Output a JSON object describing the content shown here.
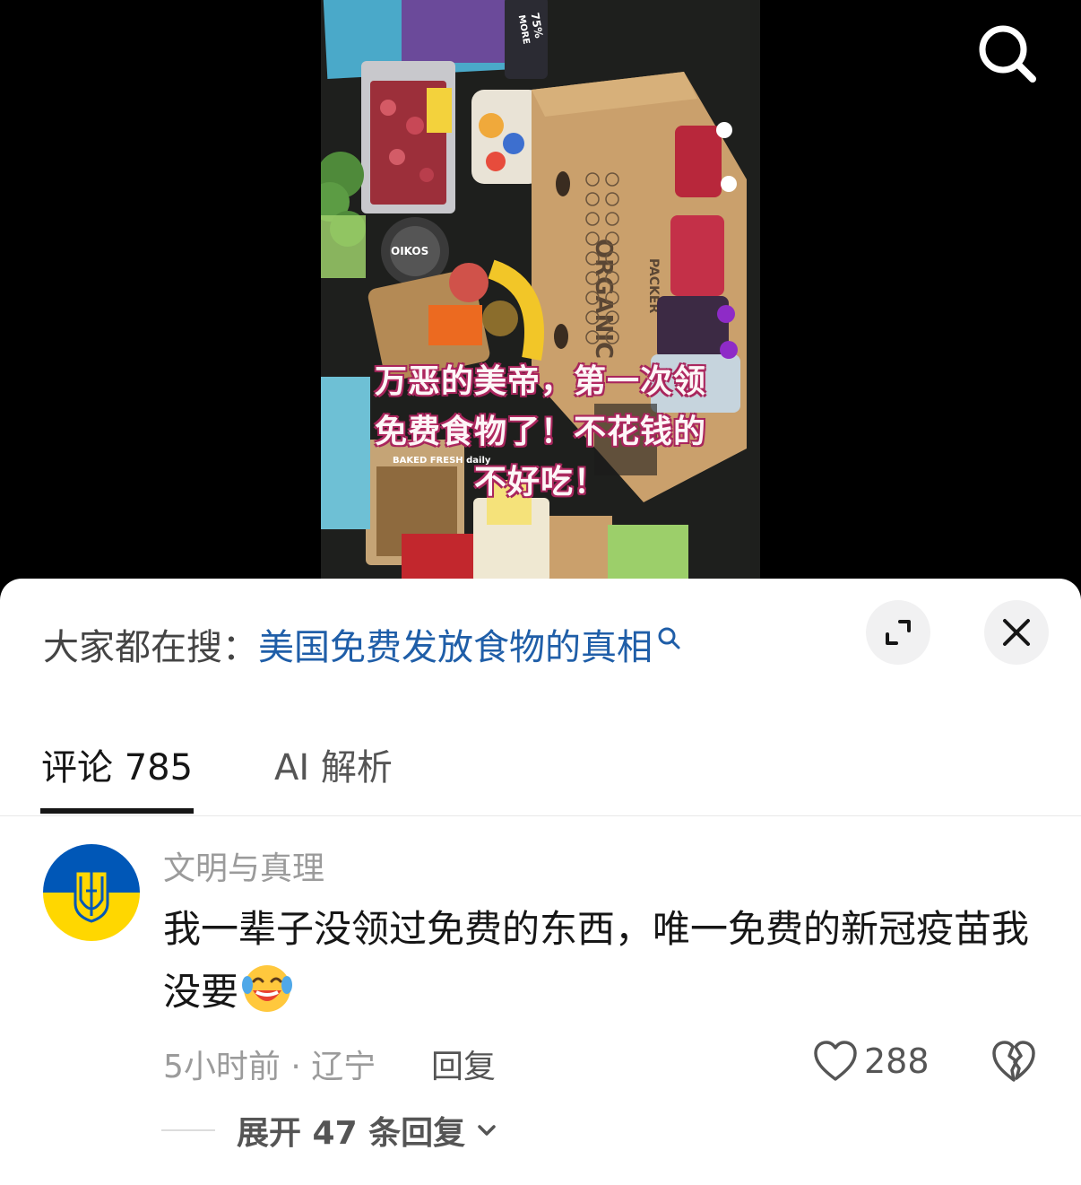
{
  "video": {
    "caption_lines": [
      "万恶的美帝，第一次领",
      "免费食物了！不花钱的",
      "不好吃！"
    ],
    "box_text": [
      "ORGANIC",
      "PACKER"
    ],
    "label_text": [
      "75%",
      "MORE",
      "OIKOS",
      "BAKED FRESH daily"
    ]
  },
  "top_bar": {
    "search_icon": "search-icon"
  },
  "sheet": {
    "trending_label": "大家都在搜：",
    "trending_query": "美国免费发放食物的真相",
    "expand_icon": "expand-icon",
    "close_icon": "close-icon"
  },
  "tabs": [
    {
      "label": "评论 785",
      "active": true
    },
    {
      "label": "AI 解析",
      "active": false
    }
  ],
  "comment": {
    "username": "文明与真理",
    "text": "我一辈子没领过免费的东西，唯一免费的新冠疫苗我没要",
    "emoji": "laughing-crying-emoji",
    "meta": "5小时前 · 辽宁",
    "reply_label": "回复",
    "like_count": "288",
    "expand_replies": "展开 47 条回复",
    "avatar_colors": [
      "#0057b7",
      "#ffd700"
    ]
  }
}
